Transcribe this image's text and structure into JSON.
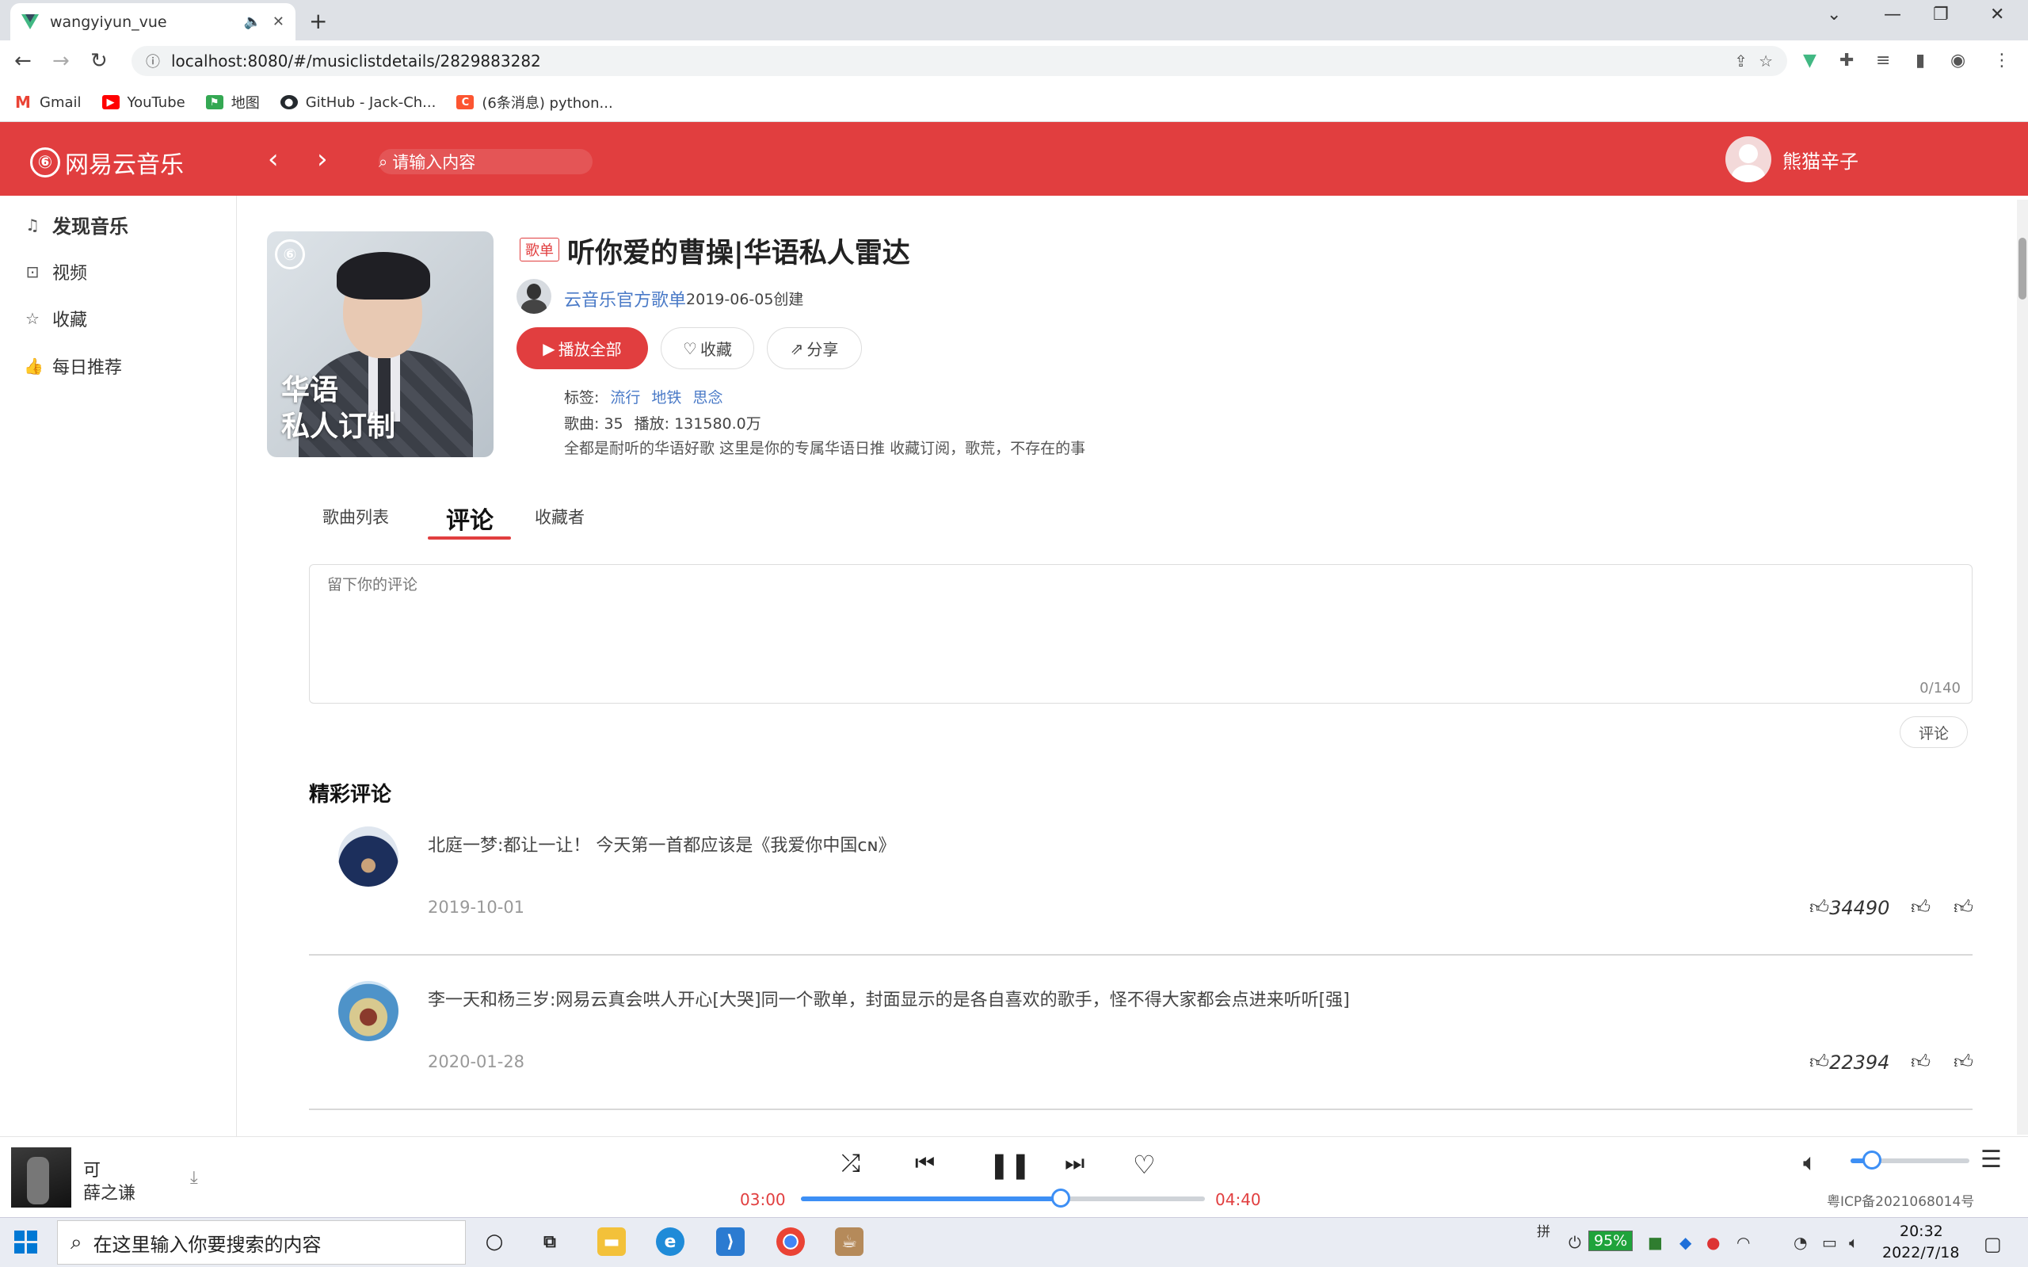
{
  "browser": {
    "tab_title": "wangyiyun_vue",
    "url": "localhost:8080/#/musiclistdetails/2829883282",
    "bookmarks": [
      {
        "label": "Gmail",
        "icon": "gmail-icon",
        "color": "#ea4335"
      },
      {
        "label": "YouTube",
        "icon": "youtube-icon",
        "color": "#ff0000"
      },
      {
        "label": "地图",
        "icon": "maps-icon",
        "color": "#34a853"
      },
      {
        "label": "GitHub - Jack-Ch...",
        "icon": "github-icon",
        "color": "#24292e"
      },
      {
        "label": "(6条消息) python...",
        "icon": "csdn-icon",
        "color": "#fc5531"
      }
    ]
  },
  "app": {
    "logo_text": "网易云音乐",
    "search_placeholder": "请输入内容",
    "username": "熊猫辛子",
    "brand_color": "#e13e3f"
  },
  "sidebar": {
    "items": [
      {
        "label": "发现音乐",
        "icon": "music-note-icon"
      },
      {
        "label": "视频",
        "icon": "video-icon"
      },
      {
        "label": "收藏",
        "icon": "star-icon"
      },
      {
        "label": "每日推荐",
        "icon": "thumbs-up-icon"
      }
    ]
  },
  "playlist": {
    "tag": "歌单",
    "title": "听你爱的曹操|华语私人雷达",
    "cover_text_line1": "华语",
    "cover_text_line2": "私人订制",
    "creator": "云音乐官方歌单",
    "created": "2019-06-05创建",
    "play_all": "播放全部",
    "favorite": "收藏",
    "share": "分享",
    "tags_label": "标签:",
    "tags": [
      "流行",
      "地铁",
      "思念"
    ],
    "songs_label": "歌曲:",
    "songs_count": "35",
    "plays_label": "播放:",
    "plays_count": "131580.0万",
    "description": "全都是耐听的华语好歌 这里是你的专属华语日推 收藏订阅，歌荒，不存在的事"
  },
  "tabs": {
    "songs": "歌曲列表",
    "comments": "评论",
    "subscribers": "收藏者"
  },
  "comment_form": {
    "placeholder": "留下你的评论",
    "counter": "0/140",
    "submit": "评论"
  },
  "hot_comments": {
    "title": "精彩评论",
    "items": [
      {
        "text": "北庭一梦:都让一让！ 今天第一首都应该是《我爱你中国cɴ》",
        "date": "2019-10-01",
        "likes": "34490"
      },
      {
        "text": "李一天和杨三岁:网易云真会哄人开心[大哭]同一个歌单，封面显示的是各自喜欢的歌手，怪不得大家都会点进来听听[强]",
        "date": "2020-01-28",
        "likes": "22394"
      }
    ]
  },
  "player": {
    "song": "可",
    "artist": "薛之谦",
    "current_time": "03:00",
    "total_time": "04:40",
    "progress": 0.643,
    "volume": 0.18,
    "icp": "粤ICP备2021068014号",
    "accent_color": "#3d8ff5"
  },
  "taskbar": {
    "search_placeholder": "在这里输入你要搜索的内容",
    "battery": "95%",
    "time": "20:32",
    "date": "2022/7/18",
    "ime": "拼"
  }
}
